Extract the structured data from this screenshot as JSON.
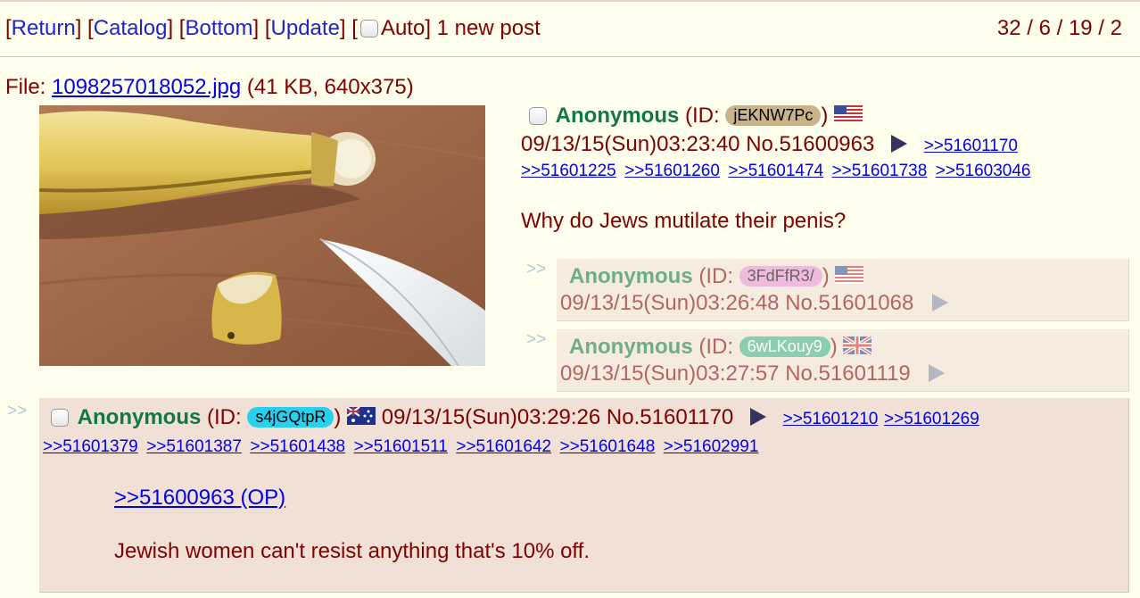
{
  "nav": {
    "return_label": "Return",
    "catalog_label": "Catalog",
    "bottom_label": "Bottom",
    "update_label": "Update",
    "auto_label": "Auto",
    "new_posts": "1 new post",
    "stats": "32 / 6 / 19 / 2"
  },
  "op": {
    "file_prefix": "File: ",
    "filename": "1098257018052.jpg",
    "file_meta": "(41 KB, 640x375)",
    "name": "Anonymous",
    "id_prefix": "(ID: ",
    "id": "jEKNW7Pc",
    "id_suffix": ")",
    "id_color": "#c9b48a",
    "flag": "us-flag",
    "datetime": "09/13/15(Sun)03:23:40",
    "post_no": "No.51600963",
    "backlinks": [
      ">>51601170",
      ">>51601225",
      ">>51601260",
      ">>51601474",
      ">>51601738",
      ">>51603046"
    ],
    "message": "Why do Jews mutilate their penis?"
  },
  "inline_replies": [
    {
      "arrows": ">>",
      "name": "Anonymous",
      "id_prefix": "(ID: ",
      "id": "3FdFfR3/",
      "id_suffix": ")",
      "id_color": "#e38fd6",
      "flag": "us-flag",
      "datetime": "09/13/15(Sun)03:26:48",
      "post_no": "No.51601068"
    },
    {
      "arrows": ">>",
      "name": "Anonymous",
      "id_prefix": "(ID: ",
      "id": "6wLKouy9",
      "id_suffix": ")",
      "id_color": "#3fae85",
      "flag": "uk-flag",
      "datetime": "09/13/15(Sun)03:27:57",
      "post_no": "No.51601119"
    }
  ],
  "reply": {
    "arrows": ">>",
    "name": "Anonymous",
    "id_prefix": "(ID: ",
    "id": "s4jGQtpR",
    "id_suffix": ")",
    "id_color": "#29d0ee",
    "flag": "au-flag",
    "datetime": "09/13/15(Sun)03:29:26",
    "post_no": "No.51601170",
    "backlinks": [
      ">>51601210",
      ">>51601269",
      ">>51601379",
      ">>51601387",
      ">>51601438",
      ">>51601511",
      ">>51601642",
      ">>51601648",
      ">>51602991"
    ],
    "quote": ">>51600963 (OP)",
    "message": "Jewish women can't resist anything that's 10% off."
  }
}
